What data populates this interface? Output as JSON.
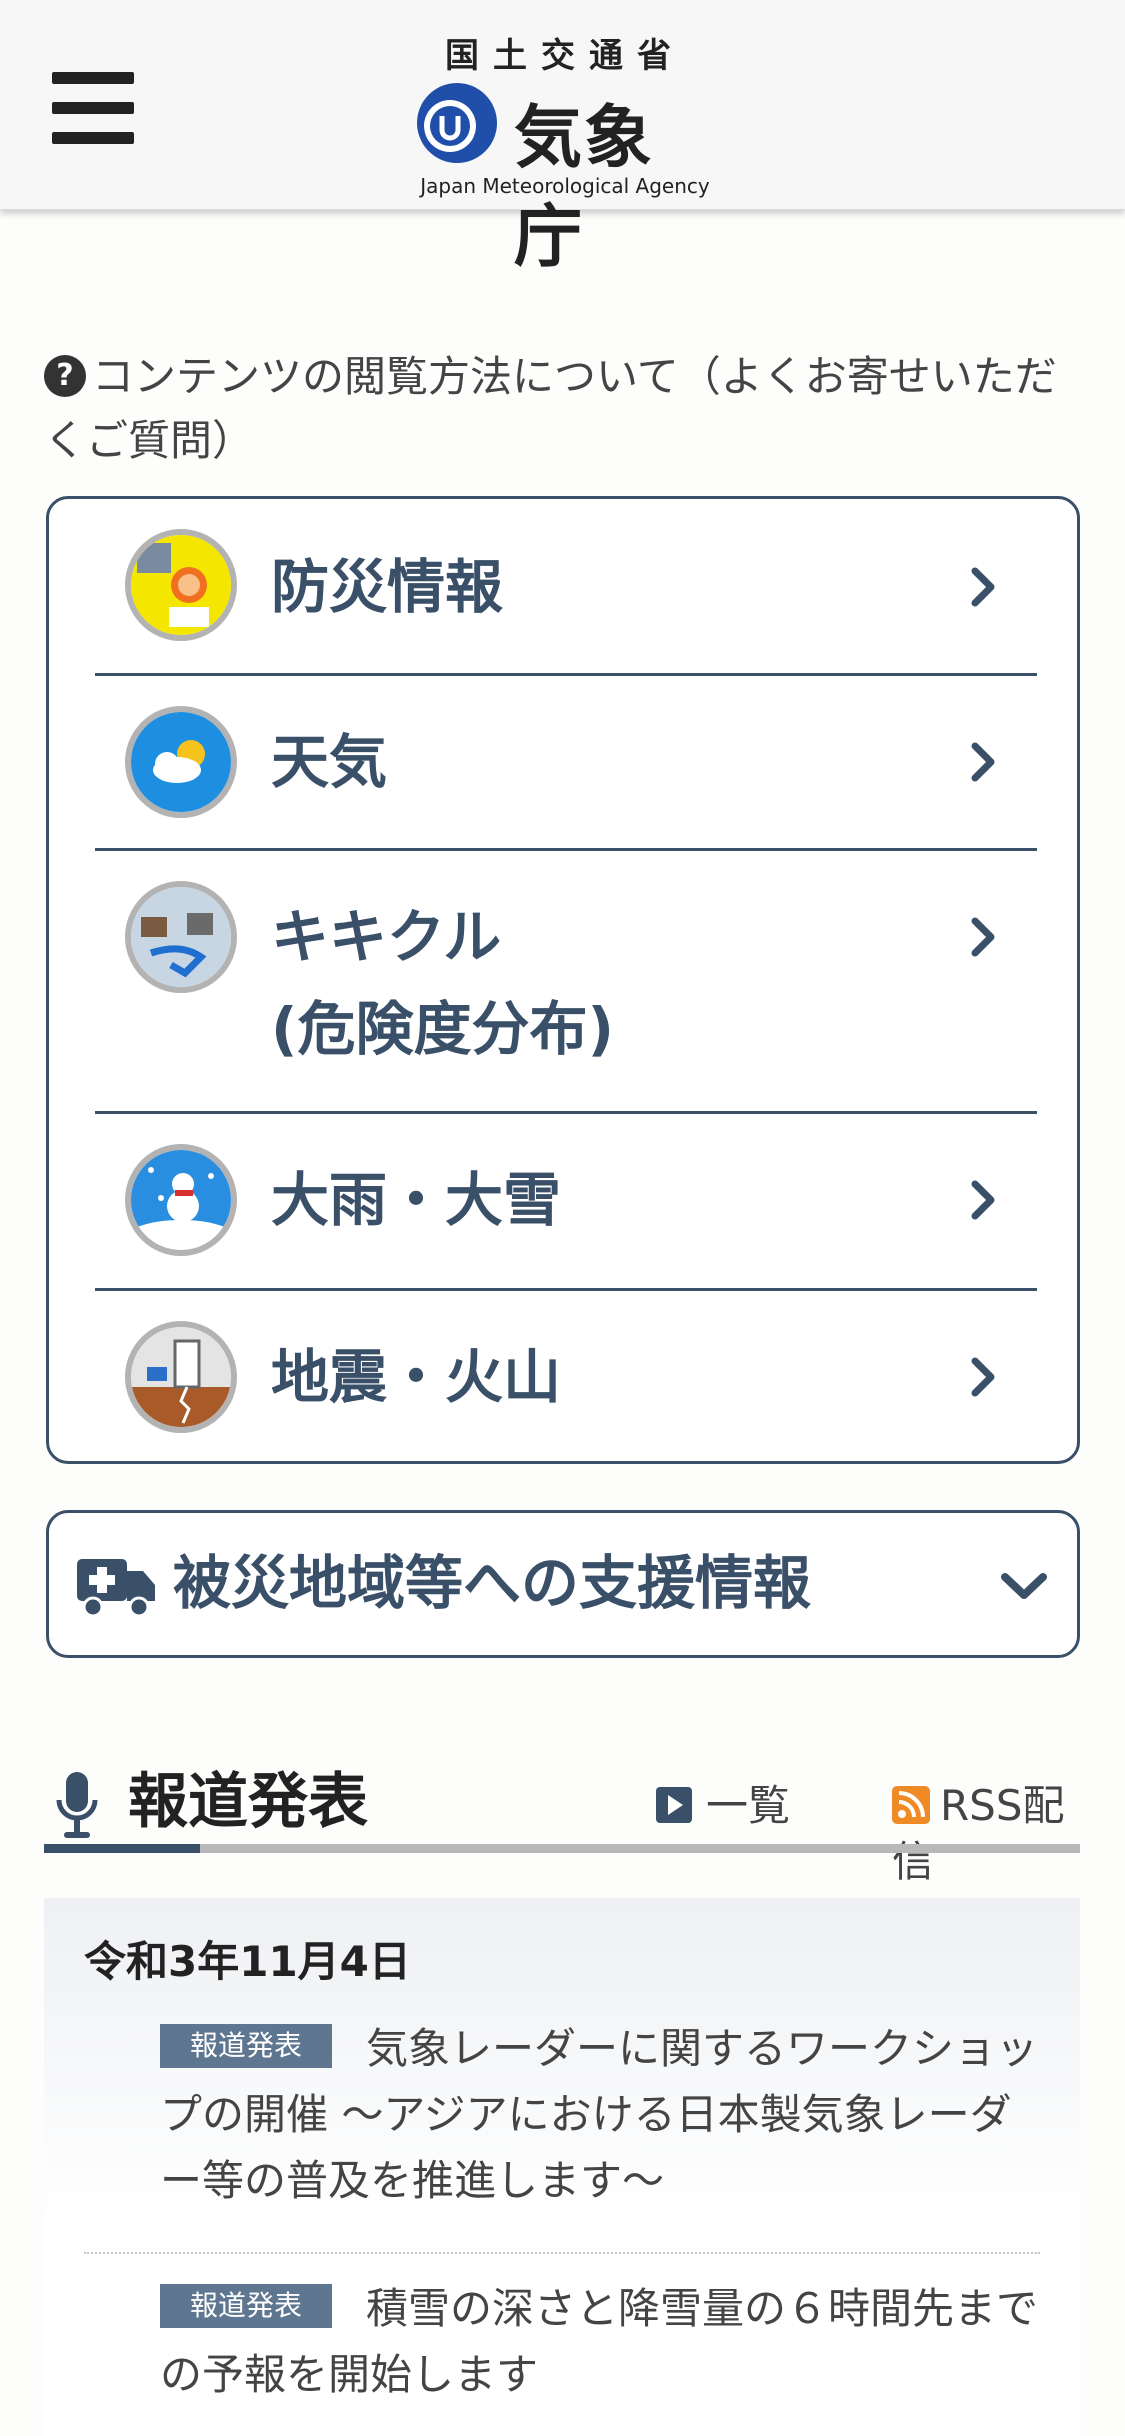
{
  "header": {
    "ministry": "国土交通省",
    "agency_jp": "気象庁",
    "agency_en": "Japan Meteorological Agency",
    "menu_icon": "hamburger-icon"
  },
  "faq": {
    "icon": "question-circle-icon",
    "text": "コンテンツの閲覧方法について（よくお寄せいただくご質問）"
  },
  "menu": [
    {
      "label": "防災情報",
      "icon": "disaster-info-icon"
    },
    {
      "label": "天気",
      "icon": "weather-icon"
    },
    {
      "label": "キキクル",
      "label2": "(危険度分布)",
      "icon": "kikikuru-icon"
    },
    {
      "label": "大雨・大雪",
      "icon": "rain-snow-icon"
    },
    {
      "label": "地震・火山",
      "icon": "earthquake-volcano-icon"
    }
  ],
  "support": {
    "label": "被災地域等への支援情報",
    "icon": "truck-icon"
  },
  "press": {
    "title": "報道発表",
    "list_label": "一覧",
    "rss_label": "RSS配信",
    "date": "令和3年11月4日",
    "items": [
      {
        "tag": "報道発表",
        "text": "気象レーダーに関するワークショップの開催 ～アジアにおける日本製気象レーダー等の普及を推進します～"
      },
      {
        "tag": "報道発表",
        "text": "積雪の深さと降雪量の６時間先までの予報を開始します"
      }
    ]
  },
  "colors": {
    "navy": "#3a4f68",
    "tag": "#5f7690",
    "rss": "#f08a24"
  }
}
